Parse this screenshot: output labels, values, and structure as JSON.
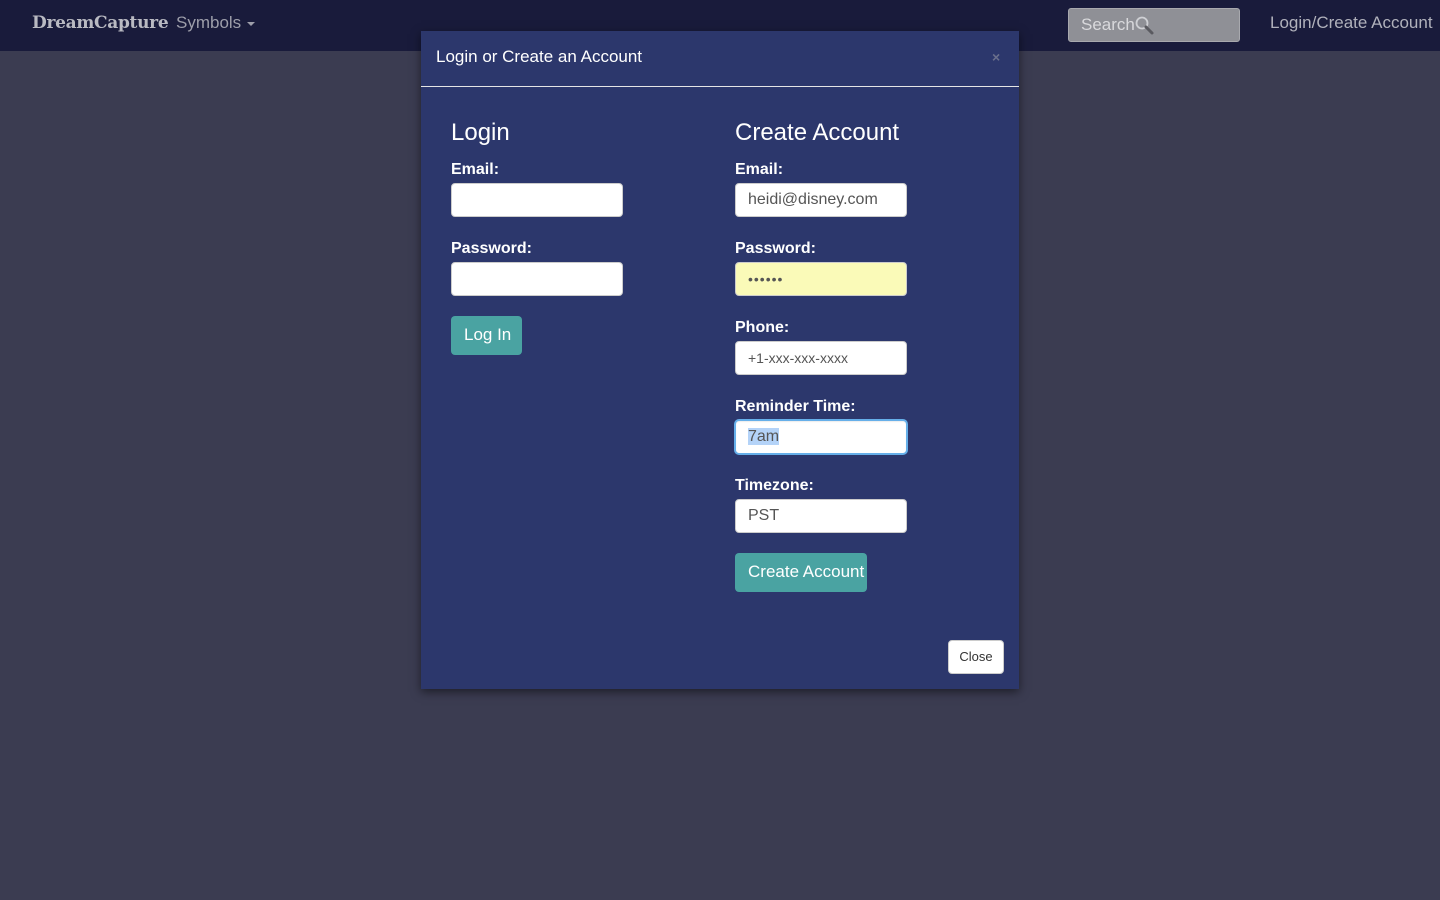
{
  "navbar": {
    "brand": "DreamCapture",
    "symbols_menu": "Symbols",
    "search_label": "Search",
    "login_link": "Login/Create Account"
  },
  "modal": {
    "title": "Login or Create an Account",
    "close_x": "×",
    "login": {
      "heading": "Login",
      "email_label": "Email:",
      "email_value": "",
      "password_label": "Password:",
      "password_value": "",
      "button": "Log In"
    },
    "create": {
      "heading": "Create Account",
      "email_label": "Email:",
      "email_value": "heidi@disney.com",
      "password_label": "Password:",
      "password_masked": "••••••",
      "phone_label": "Phone:",
      "phone_placeholder": "+1-xxx-xxx-xxxx",
      "reminder_label": "Reminder Time:",
      "reminder_value": "7am",
      "timezone_label": "Timezone:",
      "timezone_value": "PST",
      "button": "Create Account"
    },
    "close_button": "Close"
  },
  "colors": {
    "navbar_bg": "#191b3b",
    "backdrop": "#3b3c51",
    "modal_bg": "#2c376c",
    "accent_button": "#4aa3a2",
    "autofill_bg": "#fafab8"
  }
}
